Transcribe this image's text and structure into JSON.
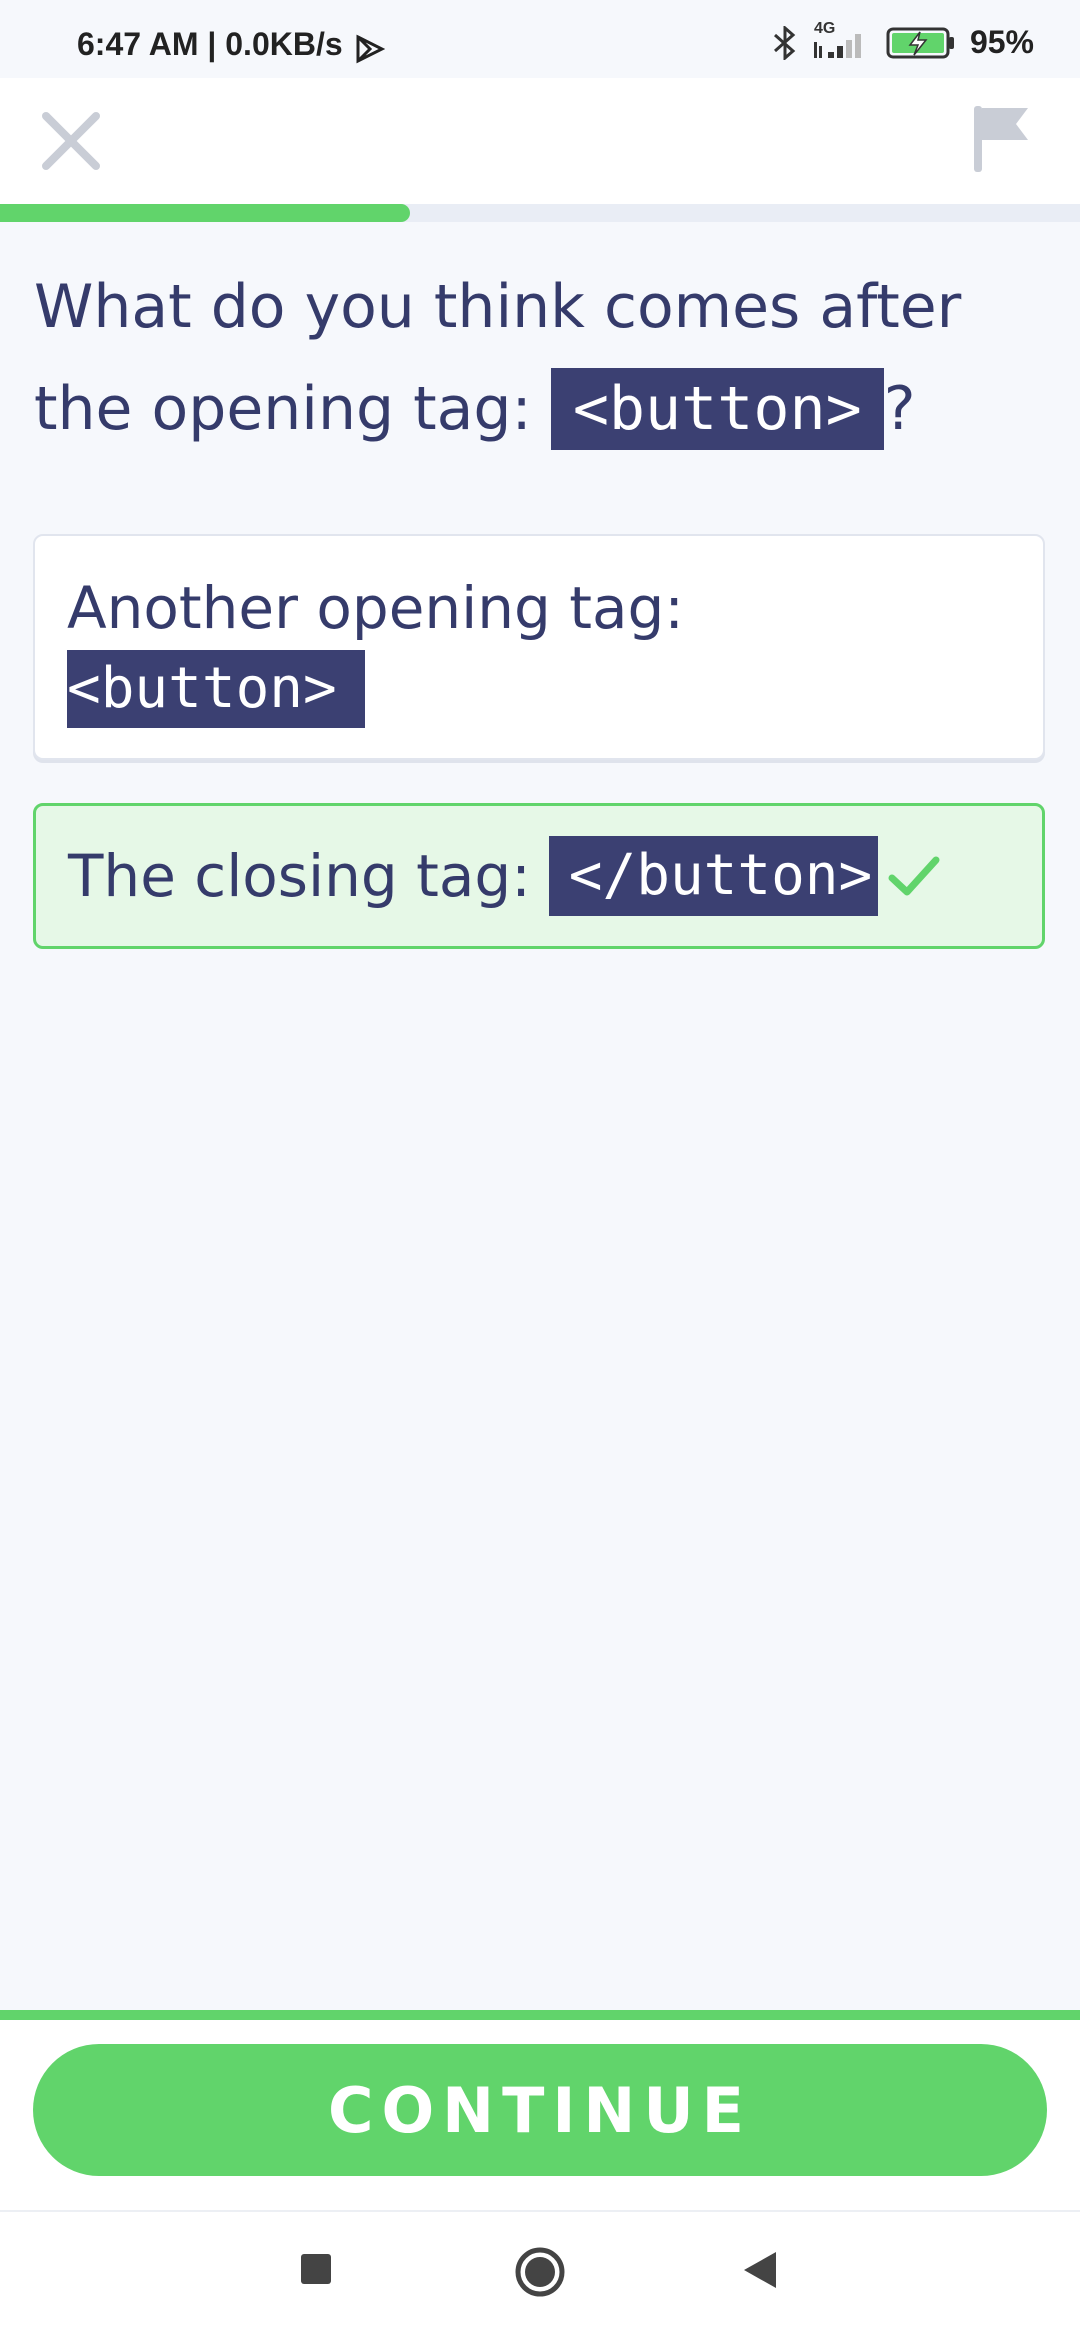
{
  "status_bar": {
    "time": "6:47 AM | 0.0KB/s",
    "network": "4G",
    "battery_percent": "95%"
  },
  "lesson": {
    "progress": 0.38
  },
  "question": {
    "prefix": "What do you think comes after the opening tag:",
    "code": "<button>",
    "suffix": "?"
  },
  "options": [
    {
      "text": "Another opening tag:",
      "code": "<button>",
      "state": "unselected"
    },
    {
      "text": "The closing tag:",
      "code": "</button>",
      "state": "correct"
    }
  ],
  "actions": {
    "continue_label": "CONTINUE"
  },
  "colors": {
    "accent_green": "#61d46b",
    "code_bg": "#3b4072",
    "text_primary": "#353b6b",
    "page_bg": "#f6f8fc"
  },
  "icons": {
    "close": "close-icon",
    "flag": "flag-icon",
    "check": "check-icon",
    "nav_recents": "square-icon",
    "nav_home": "circle-icon",
    "nav_back": "triangle-back-icon"
  }
}
